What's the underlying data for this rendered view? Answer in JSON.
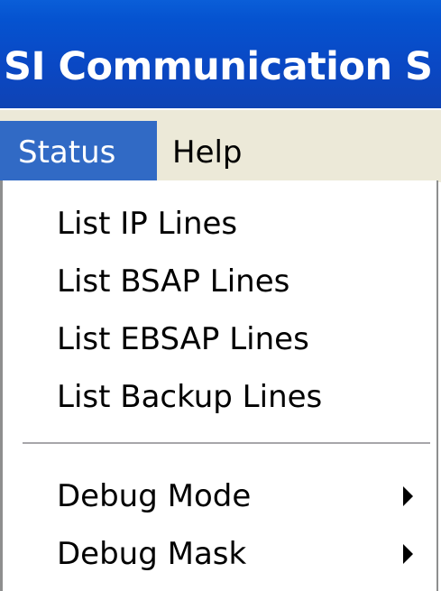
{
  "window": {
    "title": "SI Communication S"
  },
  "menubar": {
    "items": [
      {
        "label": "Status",
        "active": true
      },
      {
        "label": "Help",
        "active": false
      }
    ]
  },
  "dropdown": {
    "items": [
      {
        "label": "List IP Lines"
      },
      {
        "label": "List BSAP Lines"
      },
      {
        "label": "List EBSAP Lines"
      },
      {
        "label": "List Backup Lines"
      },
      {
        "label": "Debug Mode",
        "submenu": true
      },
      {
        "label": "Debug Mask",
        "submenu": true
      }
    ]
  },
  "colors": {
    "titlebar": "#0553d0",
    "menu_highlight": "#316ac5",
    "menubar_bg": "#ece9d8"
  }
}
